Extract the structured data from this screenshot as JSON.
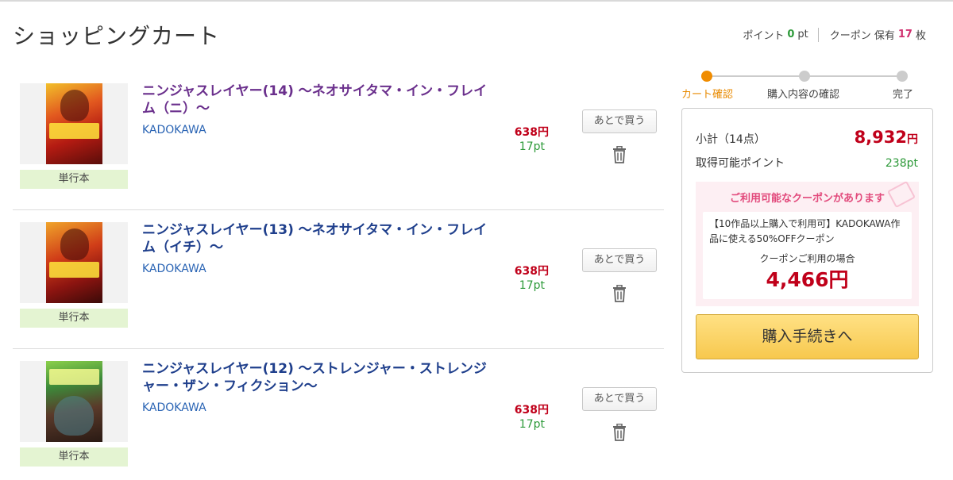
{
  "page": {
    "title": "ショッピングカート"
  },
  "header": {
    "points_label": "ポイント",
    "points_value": "0",
    "points_unit": "pt",
    "coupon_label": "クーポン 保有",
    "coupon_count": "17",
    "coupon_unit": "枚"
  },
  "items": [
    {
      "title": "ニンジャスレイヤー(14) ～ネオサイタマ・イン・フレイム（ニ）～",
      "publisher": "KADOKAWA",
      "format": "単行本",
      "price": "638円",
      "points": "17pt",
      "later_label": "あとで買う",
      "visited": true
    },
    {
      "title": "ニンジャスレイヤー(13) ～ネオサイタマ・イン・フレイム（イチ）～",
      "publisher": "KADOKAWA",
      "format": "単行本",
      "price": "638円",
      "points": "17pt",
      "later_label": "あとで買う",
      "visited": false
    },
    {
      "title": "ニンジャスレイヤー(12) ～ストレンジャー・ストレンジャー・ザン・フィクション～",
      "publisher": "KADOKAWA",
      "format": "単行本",
      "price": "638円",
      "points": "17pt",
      "later_label": "あとで買う",
      "visited": false
    }
  ],
  "steps": [
    {
      "label": "カート確認",
      "active": true
    },
    {
      "label": "購入内容の確認",
      "active": false
    },
    {
      "label": "完了",
      "active": false
    }
  ],
  "summary": {
    "subtotal_label": "小計（14点）",
    "subtotal_value": "8,932",
    "subtotal_unit": "円",
    "points_label": "取得可能ポイント",
    "points_value": "238pt",
    "coupon": {
      "heading": "ご利用可能なクーポンがあります",
      "description": "【10作品以上購入で利用可】KADOKAWA作品に使える50%OFFクーポン",
      "when_label": "クーポンご利用の場合",
      "price": "4,466円"
    },
    "checkout_label": "購入手続きへ"
  },
  "colors": {
    "accent_orange": "#f08c00",
    "price_red": "#c0001a",
    "points_green": "#2e9a3a",
    "link_blue": "#1f3f8c",
    "coupon_pink": "#e24a7c",
    "checkout_yellow": "#f7c84e"
  },
  "icons": [
    "trash-icon",
    "coupon-tag-icon",
    "step-dot-icon"
  ]
}
